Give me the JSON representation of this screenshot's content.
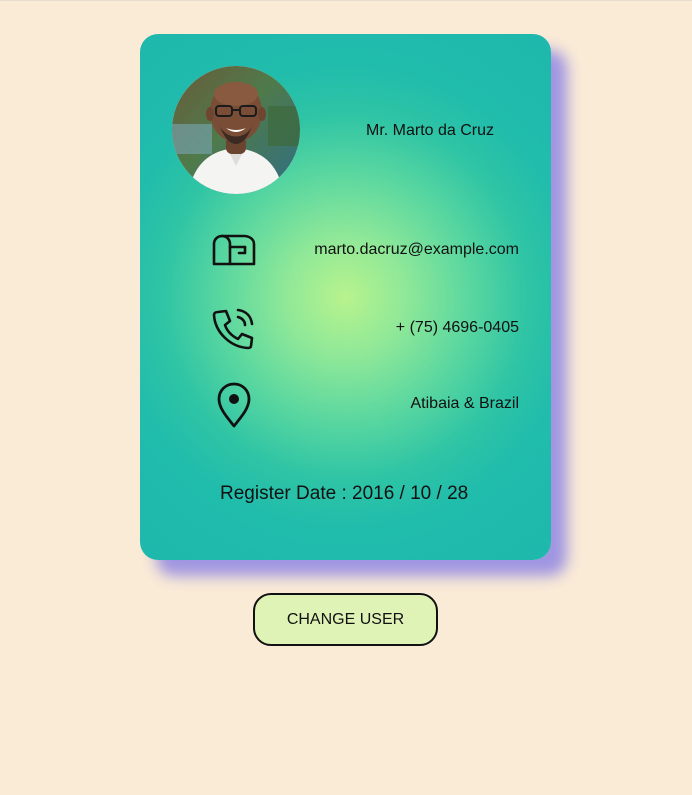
{
  "profile": {
    "name": "Mr. Marto da Cruz",
    "avatar_icon": "profile-photo",
    "email": "marto.dacruz@example.com",
    "phone": "+ (75) 4696-0405",
    "location": "Atibaia & Brazil",
    "register_date": "Register Date : 2016 / 10 / 28"
  },
  "icons": {
    "email": "mailbox-icon",
    "phone": "phone-ringing-icon",
    "location": "map-pin-icon"
  },
  "actions": {
    "change_user_label": "CHANGE USER"
  },
  "colors": {
    "page_background": "#faebd7",
    "card_gradient_center": "#b8f38d",
    "card_gradient_edge": "#1fb8ac",
    "card_shadow": "#968ce2",
    "button_background": "#e0f3b7"
  }
}
